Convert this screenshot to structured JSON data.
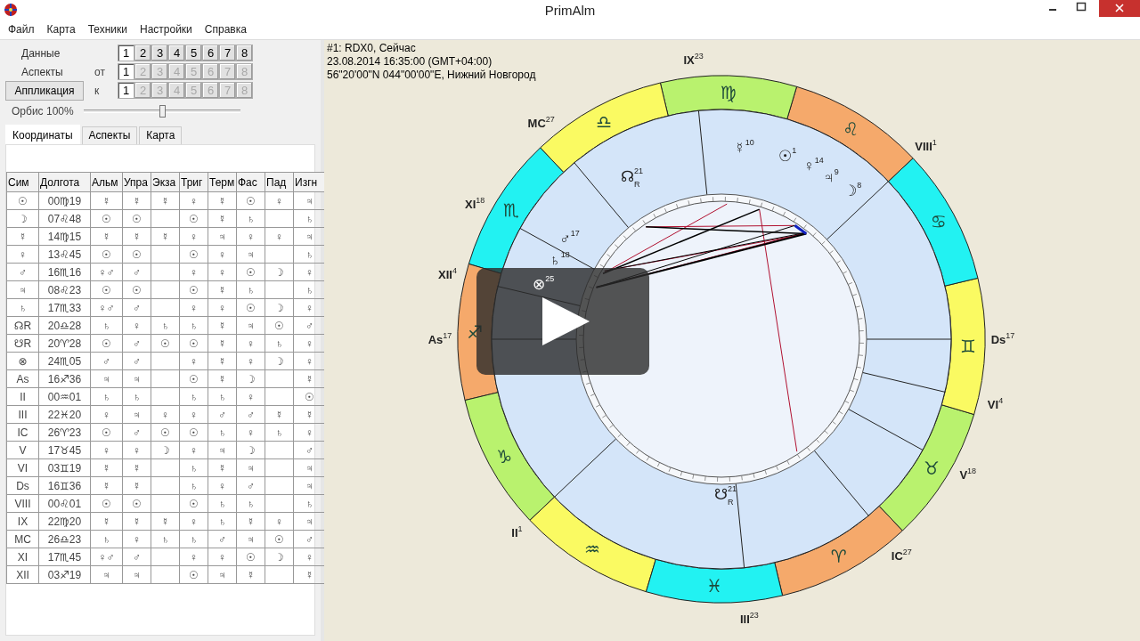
{
  "window": {
    "title": "PrimAlm"
  },
  "menu": [
    "Файл",
    "Карта",
    "Техники",
    "Настройки",
    "Справка"
  ],
  "data_row": {
    "label": "Данные",
    "buttons": [
      {
        "label": "1",
        "selected": true
      },
      {
        "label": "2",
        "selected": false
      },
      {
        "label": "3",
        "selected": false
      },
      {
        "label": "4",
        "selected": false
      },
      {
        "label": "5",
        "selected": false
      },
      {
        "label": "6",
        "selected": false
      },
      {
        "label": "7",
        "selected": false
      },
      {
        "label": "8",
        "selected": false
      }
    ]
  },
  "aspects_from": {
    "label": "Аспекты",
    "prefix": "от",
    "buttons": [
      {
        "label": "1",
        "disabled": false
      },
      {
        "label": "2",
        "disabled": true
      },
      {
        "label": "3",
        "disabled": true
      },
      {
        "label": "4",
        "disabled": true
      },
      {
        "label": "5",
        "disabled": true
      },
      {
        "label": "6",
        "disabled": true
      },
      {
        "label": "7",
        "disabled": true
      },
      {
        "label": "8",
        "disabled": true
      }
    ]
  },
  "aspects_to": {
    "button": "Аппликация",
    "prefix": "к",
    "buttons": [
      {
        "label": "1",
        "disabled": false
      },
      {
        "label": "2",
        "disabled": true
      },
      {
        "label": "3",
        "disabled": true
      },
      {
        "label": "4",
        "disabled": true
      },
      {
        "label": "5",
        "disabled": true
      },
      {
        "label": "6",
        "disabled": true
      },
      {
        "label": "7",
        "disabled": true
      },
      {
        "label": "8",
        "disabled": true
      }
    ]
  },
  "orbis": {
    "label": "Орбис",
    "reading": "100%",
    "level": 0.5
  },
  "tabs": [
    {
      "label": "Координаты",
      "selected": true
    },
    {
      "label": "Аспекты",
      "selected": false
    },
    {
      "label": "Карта",
      "selected": false
    }
  ],
  "table": {
    "columns": [
      "Сим",
      "Долгота",
      "Альм",
      "Упра",
      "Экза",
      "Триг",
      "Терм",
      "Фас",
      "Пад",
      "Изгн"
    ],
    "rows": [
      {
        "cells": [
          "☉",
          "00♍19",
          "☿",
          "☿",
          "☿",
          "♀",
          "☿",
          "☉",
          "♀",
          "♃"
        ]
      },
      {
        "cells": [
          "☽",
          "07♌48",
          "☉",
          "☉",
          null,
          "☉",
          "☿",
          "♄",
          null,
          "♄"
        ]
      },
      {
        "cells": [
          "☿",
          "14♍15",
          "☿",
          "☿",
          "☿",
          "♀",
          "♃",
          "♀",
          "♀",
          "♃"
        ]
      },
      {
        "cells": [
          "♀",
          "13♌45",
          "☉",
          "☉",
          null,
          "☉",
          "♀",
          "♃",
          null,
          "♄"
        ]
      },
      {
        "cells": [
          "♂",
          "16♏16",
          "♀♂",
          "♂",
          null,
          "♀",
          "♀",
          "☉",
          "☽",
          "♀"
        ]
      },
      {
        "cells": [
          "♃",
          "08♌23",
          "☉",
          "☉",
          null,
          "☉",
          "☿",
          "♄",
          null,
          "♄"
        ]
      },
      {
        "cells": [
          "♄",
          "17♏33",
          "♀♂",
          "♂",
          null,
          "♀",
          "♀",
          "☉",
          "☽",
          "♀"
        ]
      },
      {
        "cells": [
          "☊R",
          "20♎28",
          "♄",
          "♀",
          "♄",
          "♄",
          "☿",
          "♃",
          "☉",
          "♂"
        ]
      },
      {
        "cells": [
          "☋R",
          "20♈28",
          "☉",
          "♂",
          "☉",
          "☉",
          "☿",
          "♀",
          "♄",
          "♀"
        ]
      },
      {
        "cells": [
          "⊗",
          "24♏05",
          "♂",
          "♂",
          null,
          "♀",
          "☿",
          "♀",
          "☽",
          "♀"
        ]
      },
      {
        "cells": [
          "As",
          "16♐36",
          "♃",
          "♃",
          null,
          "☉",
          "☿",
          "☽",
          null,
          "☿"
        ]
      },
      {
        "cells": [
          "II",
          "00♒01",
          "♄",
          "♄",
          null,
          "♄",
          "♄",
          "♀",
          null,
          "☉"
        ]
      },
      {
        "cells": [
          "III",
          "22♓20",
          "♀",
          "♃",
          "♀",
          "♀",
          "♂",
          "♂",
          "☿",
          "☿"
        ]
      },
      {
        "cells": [
          "IC",
          "26♈23",
          "☉",
          "♂",
          "☉",
          "☉",
          "♄",
          "♀",
          "♄",
          "♀"
        ]
      },
      {
        "cells": [
          "V",
          "17♉45",
          "♀",
          "♀",
          "☽",
          "♀",
          "♃",
          "☽",
          null,
          "♂"
        ]
      },
      {
        "cells": [
          "VI",
          "03♊19",
          "☿",
          "☿",
          null,
          "♄",
          "☿",
          "♃",
          null,
          "♃"
        ]
      },
      {
        "cells": [
          "Ds",
          "16♊36",
          "☿",
          "☿",
          null,
          "♄",
          "♀",
          "♂",
          null,
          "♃"
        ]
      },
      {
        "cells": [
          "VIII",
          "00♌01",
          "☉",
          "☉",
          null,
          "☉",
          "♄",
          "♄",
          null,
          "♄"
        ]
      },
      {
        "cells": [
          "IX",
          "22♍20",
          "☿",
          "☿",
          "☿",
          "♀",
          "♄",
          "☿",
          "♀",
          "♃"
        ]
      },
      {
        "cells": [
          "MC",
          "26♎23",
          "♄",
          "♀",
          "♄",
          "♄",
          "♂",
          "♃",
          "☉",
          "♂"
        ]
      },
      {
        "cells": [
          "XI",
          "17♏45",
          "♀♂",
          "♂",
          null,
          "♀",
          "♀",
          "☉",
          "☽",
          "♀"
        ]
      },
      {
        "cells": [
          "XII",
          "03♐19",
          "♃",
          "♃",
          null,
          "☉",
          "♃",
          "☿",
          null,
          "☿"
        ]
      }
    ]
  },
  "chart_header": [
    "#1: RDX0, Сейчас",
    "23.08.2014  16:35:00 (GMT+04:00)",
    "56\"20'00\"N  044\"00'00\"E, Нижний Новгород"
  ],
  "signs": [
    {
      "glyph": "♈",
      "color": "#f5a96b"
    },
    {
      "glyph": "♉",
      "color": "#b9f26e"
    },
    {
      "glyph": "♊",
      "color": "#fafa62"
    },
    {
      "glyph": "♋",
      "color": "#22f2f2"
    },
    {
      "glyph": "♌",
      "color": "#f5a96b"
    },
    {
      "glyph": "♍",
      "color": "#b9f26e"
    },
    {
      "glyph": "♎",
      "color": "#fafa62"
    },
    {
      "glyph": "♏",
      "color": "#22f2f2"
    },
    {
      "glyph": "♐",
      "color": "#f5a96b"
    },
    {
      "glyph": "♑",
      "color": "#b9f26e"
    },
    {
      "glyph": "♒",
      "color": "#fafa62"
    },
    {
      "glyph": "♓",
      "color": "#22f2f2"
    }
  ],
  "houses": [
    {
      "label": "As",
      "degree": "17"
    },
    {
      "label": "II",
      "degree": "1"
    },
    {
      "label": "III",
      "degree": "23"
    },
    {
      "label": "IC",
      "degree": "27"
    },
    {
      "label": "V",
      "degree": "18"
    },
    {
      "label": "VI",
      "degree": "4"
    },
    {
      "label": "Ds",
      "degree": "17"
    },
    {
      "label": "VIII",
      "degree": "1"
    },
    {
      "label": "IX",
      "degree": "23"
    },
    {
      "label": "MC",
      "degree": "27"
    },
    {
      "label": "XI",
      "degree": "18"
    },
    {
      "label": "XII",
      "degree": "4"
    }
  ],
  "planets": [
    {
      "glyph": "☉",
      "degree": "1"
    },
    {
      "glyph": "☽",
      "degree": "8"
    },
    {
      "glyph": "☿",
      "degree": "10"
    },
    {
      "glyph": "♀",
      "degree": "14"
    },
    {
      "glyph": "♂",
      "degree": "17"
    },
    {
      "glyph": "♃",
      "degree": "9"
    },
    {
      "glyph": "♄",
      "degree": "18"
    },
    {
      "glyph": "☊",
      "degree": "21",
      "retro": "R"
    },
    {
      "glyph": "☋",
      "degree": "21",
      "retro": "R"
    },
    {
      "glyph": "⊗",
      "degree": "25"
    }
  ]
}
